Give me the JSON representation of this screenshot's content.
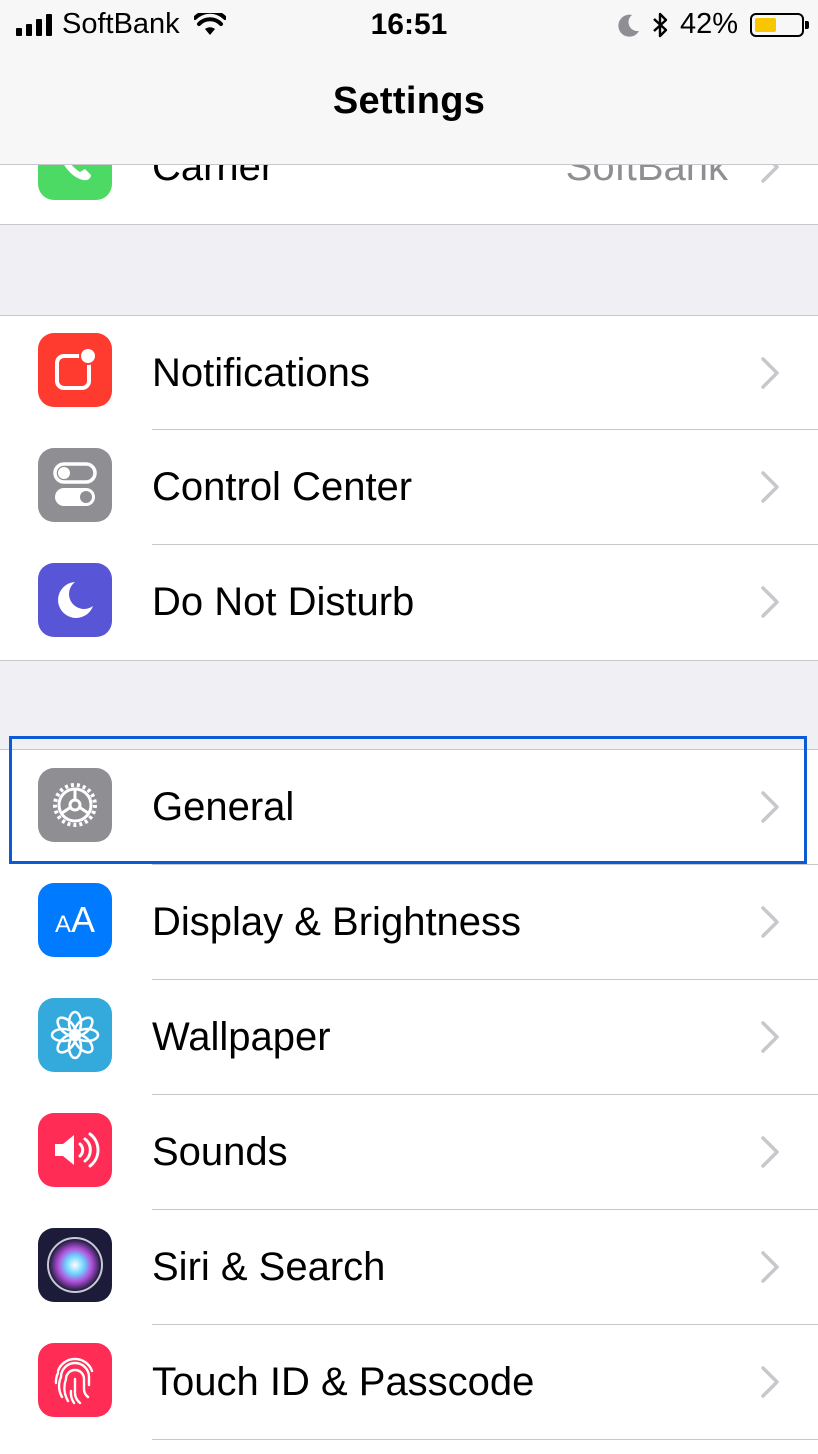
{
  "status_bar": {
    "carrier": "SoftBank",
    "time": "16:51",
    "battery_percent": "42%",
    "battery_level": 0.42,
    "icons": [
      "signal-icon",
      "wifi-icon",
      "moon-icon",
      "bluetooth-icon",
      "battery-icon"
    ]
  },
  "navbar": {
    "title": "Settings"
  },
  "groups": {
    "carrier": {
      "label": "Carrier",
      "value": "SoftBank",
      "icon": "phone-icon",
      "color": "#4cd964"
    },
    "alerts": [
      {
        "label": "Notifications",
        "icon": "notifications-icon",
        "color": "#ff3b30"
      },
      {
        "label": "Control Center",
        "icon": "control-center-icon",
        "color": "#8e8e93"
      },
      {
        "label": "Do Not Disturb",
        "icon": "moon-icon",
        "color": "#5856d6"
      }
    ],
    "device": [
      {
        "label": "General",
        "icon": "gear-icon",
        "color": "#8e8e93"
      },
      {
        "label": "Display & Brightness",
        "icon": "display-icon",
        "color": "#007aff",
        "icon_text": "AA"
      },
      {
        "label": "Wallpaper",
        "icon": "wallpaper-flower-icon",
        "color": "#34aadc"
      },
      {
        "label": "Sounds",
        "icon": "speaker-icon",
        "color": "#ff2d55"
      },
      {
        "label": "Siri & Search",
        "icon": "siri-icon",
        "color": "#1c1c3a"
      },
      {
        "label": "Touch ID & Passcode",
        "icon": "fingerprint-icon",
        "color": "#ff2d55"
      }
    ]
  },
  "highlight": {
    "target": "General",
    "color": "#0c5ad6"
  }
}
